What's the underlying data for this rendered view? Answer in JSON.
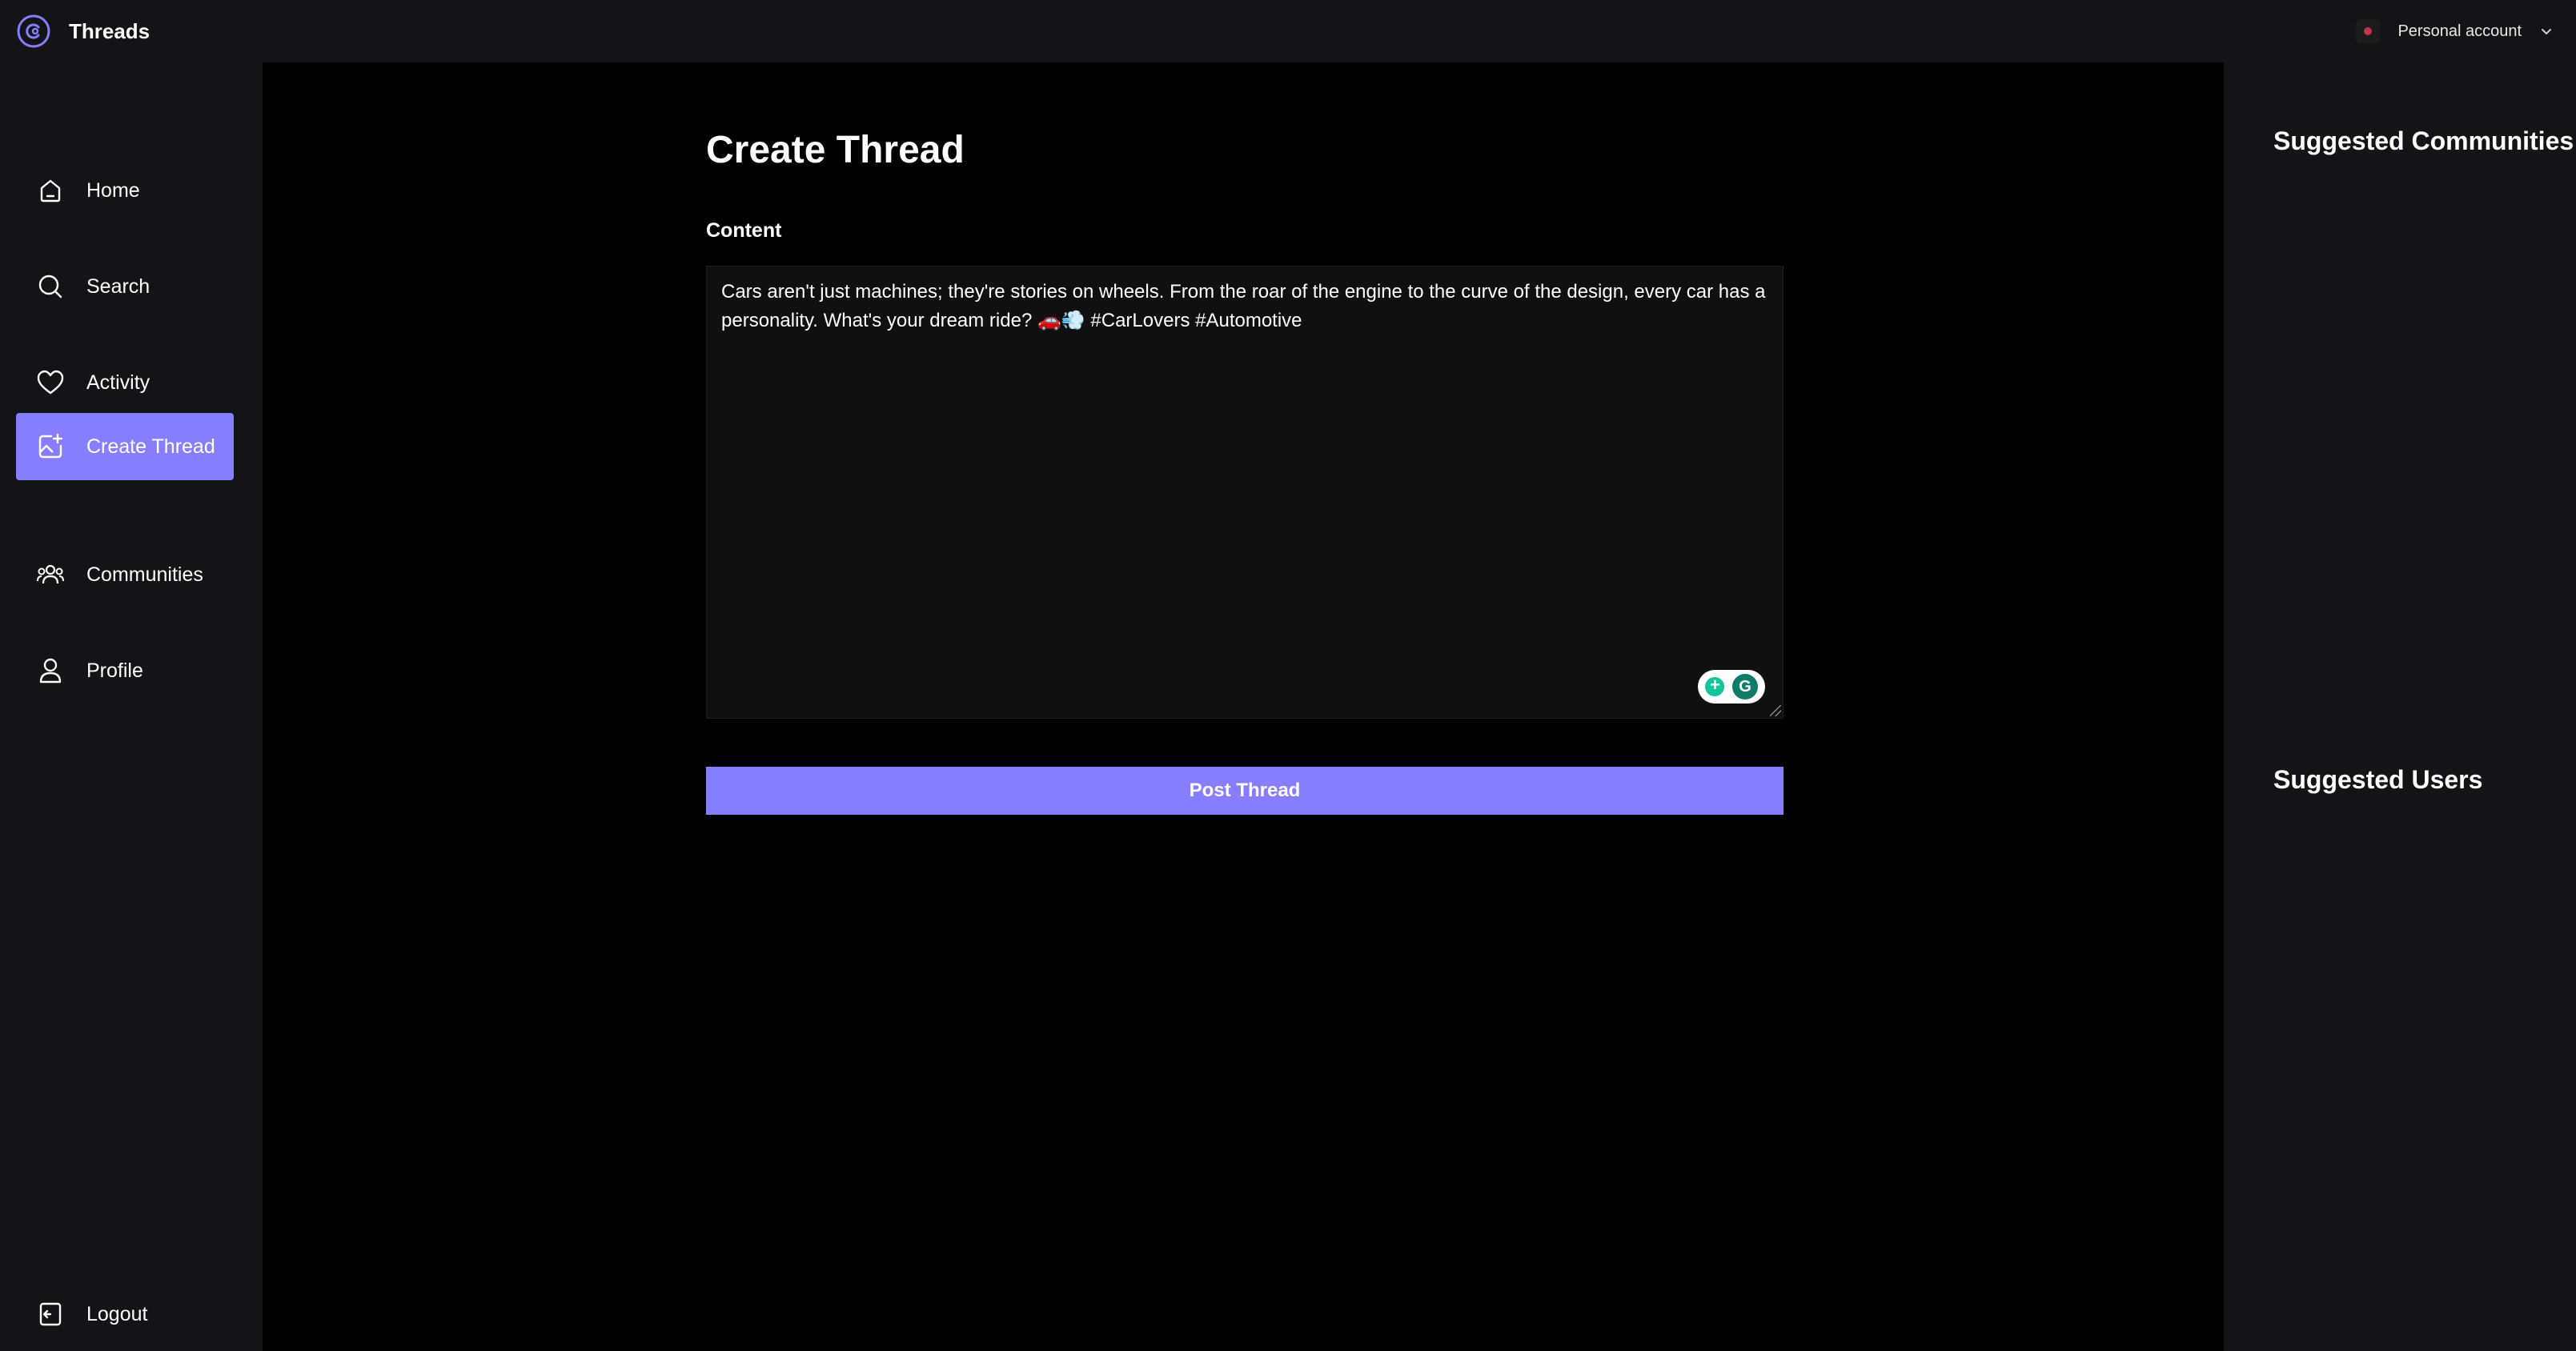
{
  "app": {
    "name": "Threads",
    "logo_icon": "threads-logo-icon"
  },
  "account": {
    "label": "Personal account",
    "avatar_icon": "organization-avatar",
    "chevron_icon": "chevron-down-icon"
  },
  "sidebar": {
    "items": [
      {
        "label": "Home",
        "icon": "home-icon",
        "active": false
      },
      {
        "label": "Search",
        "icon": "search-icon",
        "active": false
      },
      {
        "label": "Activity",
        "icon": "heart-icon",
        "active": false
      },
      {
        "label": "Create Thread",
        "icon": "create-icon",
        "active": true
      },
      {
        "label": "Communities",
        "icon": "community-icon",
        "active": false
      },
      {
        "label": "Profile",
        "icon": "user-icon",
        "active": false
      }
    ],
    "logout_label": "Logout"
  },
  "main": {
    "title": "Create Thread",
    "content_label": "Content",
    "content_value": "Cars aren't just machines; they're stories on wheels. From the roar of the engine to the curve of the design, every car has a personality. What's your dream ride? 🚗💨 #CarLovers #Automotive",
    "post_button": "Post Thread"
  },
  "rightbar": {
    "suggested_communities": "Suggested Communities",
    "suggested_users": "Suggested Users"
  },
  "colors": {
    "accent": "#877eff",
    "panel": "#121417",
    "background": "#000000",
    "input_bg": "#101012"
  }
}
